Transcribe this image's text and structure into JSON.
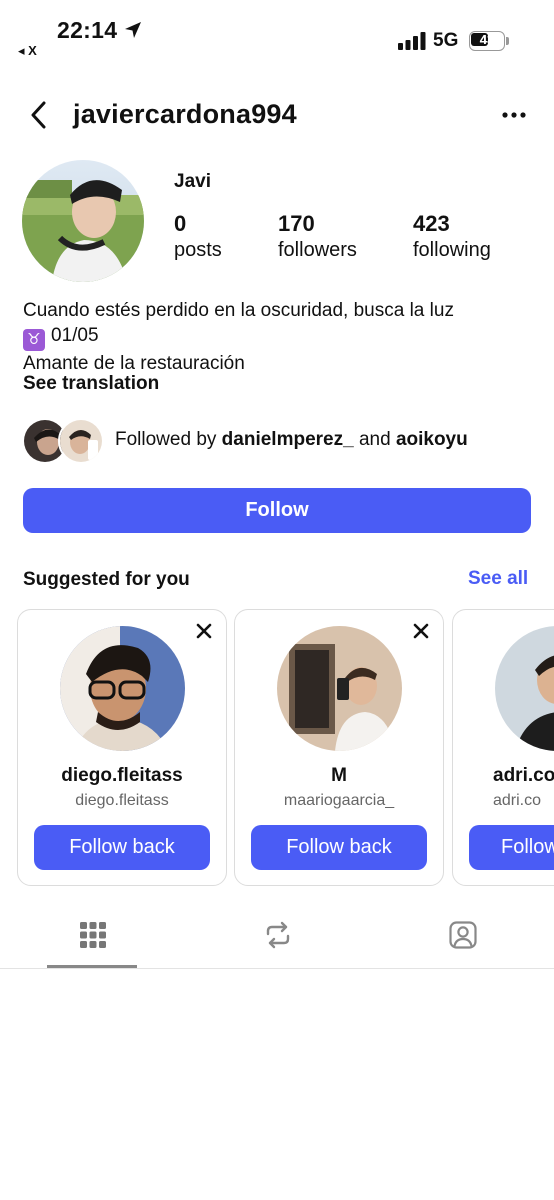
{
  "status_bar": {
    "time": "22:14",
    "back_app": "◂ X",
    "network": "5G",
    "battery": "43"
  },
  "header": {
    "username": "javiercardona994"
  },
  "profile": {
    "display_name": "Javi",
    "stats": [
      {
        "value": "0",
        "label": "posts"
      },
      {
        "value": "170",
        "label": "followers"
      },
      {
        "value": "423",
        "label": "following"
      }
    ],
    "bio": {
      "line1": "Cuando estés perdido en la oscuridad, busca la luz",
      "line2_emoji": "♉",
      "line2_text": "01/05",
      "line3": "Amante de la restauración"
    },
    "see_translation": "See translation",
    "followed_by": {
      "prefix": "Followed by",
      "user1": "danielmperez_",
      "joiner": "and",
      "user2": "aoikoyu"
    },
    "follow_label": "Follow"
  },
  "suggested": {
    "title": "Suggested for you",
    "see_all": "See all",
    "cards": [
      {
        "name": "diego.fleitass",
        "handle": "diego.fleitass",
        "button": "Follow back"
      },
      {
        "name": "M",
        "handle": "maariogaarcia_",
        "button": "Follow back"
      },
      {
        "name": "adri.co",
        "handle": "adri.co",
        "button": "Follow"
      }
    ]
  },
  "colors": {
    "accent": "#4a5cf5"
  }
}
